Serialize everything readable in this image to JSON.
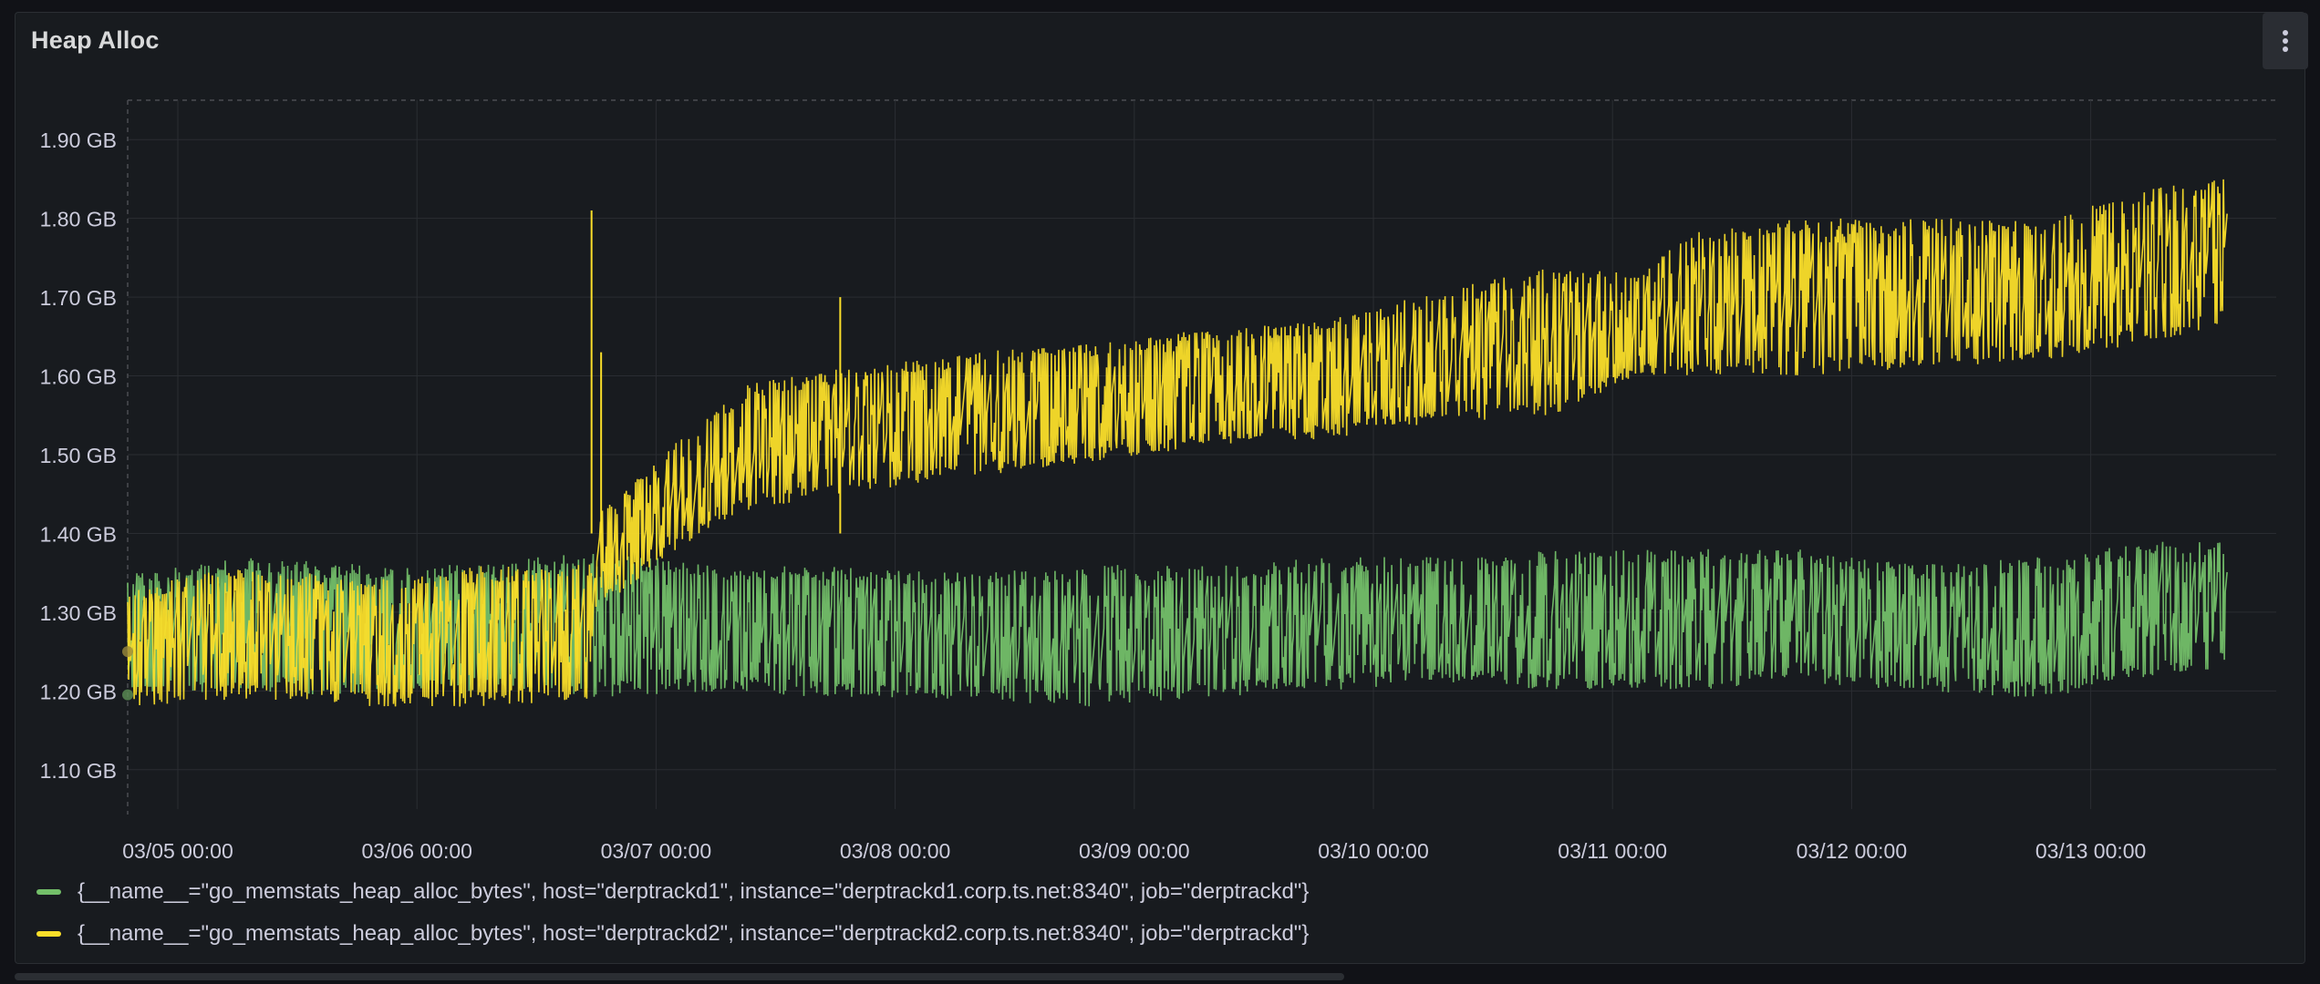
{
  "panel": {
    "title": "Heap Alloc",
    "menu_icon": "vertical-ellipsis-icon"
  },
  "colors": {
    "background": "#181b1f",
    "series_green": "#73bf69",
    "series_yellow": "#fade2a",
    "axis_text": "#ccccdc",
    "grid": "#2c2f34"
  },
  "chart_data": {
    "type": "line",
    "title": "Heap Alloc",
    "y_unit": "GB",
    "ylim": [
      1.05,
      1.95
    ],
    "y_ticks": [
      {
        "value": 1.9,
        "label": "1.90 GB"
      },
      {
        "value": 1.8,
        "label": "1.80 GB"
      },
      {
        "value": 1.7,
        "label": "1.70 GB"
      },
      {
        "value": 1.6,
        "label": "1.60 GB"
      },
      {
        "value": 1.5,
        "label": "1.50 GB"
      },
      {
        "value": 1.4,
        "label": "1.40 GB"
      },
      {
        "value": 1.3,
        "label": "1.30 GB"
      },
      {
        "value": 1.2,
        "label": "1.20 GB"
      },
      {
        "value": 1.1,
        "label": "1.10 GB"
      }
    ],
    "xlim": [
      "03/05",
      "03/13 + 18h"
    ],
    "x_ticks": [
      "03/05 00:00",
      "03/06 00:00",
      "03/07 00:00",
      "03/08 00:00",
      "03/09 00:00",
      "03/10 00:00",
      "03/11 00:00",
      "03/12 00:00",
      "03/13 00:00"
    ],
    "grid": true,
    "legend_position": "bottom-left",
    "series": [
      {
        "name": "{__name__=\"go_memstats_heap_alloc_bytes\", host=\"derptrackd1\", instance=\"derptrackd1.corp.ts.net:8340\", job=\"derptrackd\"}",
        "color": "#73bf69",
        "envelope_days": [
          0,
          0.5,
          1,
          1.5,
          1.94,
          2.5,
          3,
          3.5,
          4,
          4.5,
          5,
          5.5,
          6,
          6.5,
          7,
          7.5,
          8,
          8.5,
          8.78
        ],
        "envelope_low": [
          1.19,
          1.2,
          1.19,
          1.2,
          1.19,
          1.2,
          1.19,
          1.19,
          1.18,
          1.19,
          1.2,
          1.21,
          1.2,
          1.2,
          1.21,
          1.2,
          1.19,
          1.22,
          1.23
        ],
        "envelope_high": [
          1.35,
          1.37,
          1.36,
          1.36,
          1.38,
          1.36,
          1.36,
          1.35,
          1.36,
          1.36,
          1.37,
          1.37,
          1.38,
          1.38,
          1.38,
          1.36,
          1.37,
          1.39,
          1.39
        ]
      },
      {
        "name": "{__name__=\"go_memstats_heap_alloc_bytes\", host=\"derptrackd2\", instance=\"derptrackd2.corp.ts.net:8340\", job=\"derptrackd\"}",
        "color": "#fade2a",
        "envelope_days": [
          0,
          0.5,
          1,
          1.5,
          1.93,
          1.95,
          2.3,
          2.6,
          3,
          3.5,
          4,
          4.5,
          5,
          5.5,
          6,
          6.3,
          6.6,
          7,
          7.5,
          8,
          8.5,
          8.78
        ],
        "envelope_low": [
          1.18,
          1.19,
          1.18,
          1.18,
          1.19,
          1.3,
          1.38,
          1.43,
          1.45,
          1.47,
          1.49,
          1.51,
          1.52,
          1.54,
          1.55,
          1.6,
          1.6,
          1.6,
          1.61,
          1.62,
          1.64,
          1.67
        ],
        "envelope_high": [
          1.33,
          1.36,
          1.34,
          1.36,
          1.36,
          1.42,
          1.52,
          1.59,
          1.61,
          1.63,
          1.64,
          1.66,
          1.67,
          1.71,
          1.74,
          1.73,
          1.79,
          1.8,
          1.8,
          1.8,
          1.84,
          1.85
        ],
        "spikes": [
          {
            "day": 1.94,
            "value": 1.81
          },
          {
            "day": 1.98,
            "value": 1.63
          },
          {
            "day": 2.98,
            "value": 1.7
          }
        ]
      }
    ]
  },
  "legend": {
    "items": [
      {
        "label": "{__name__=\"go_memstats_heap_alloc_bytes\", host=\"derptrackd1\", instance=\"derptrackd1.corp.ts.net:8340\", job=\"derptrackd\"}"
      },
      {
        "label": "{__name__=\"go_memstats_heap_alloc_bytes\", host=\"derptrackd2\", instance=\"derptrackd2.corp.ts.net:8340\", job=\"derptrackd\"}"
      }
    ]
  }
}
